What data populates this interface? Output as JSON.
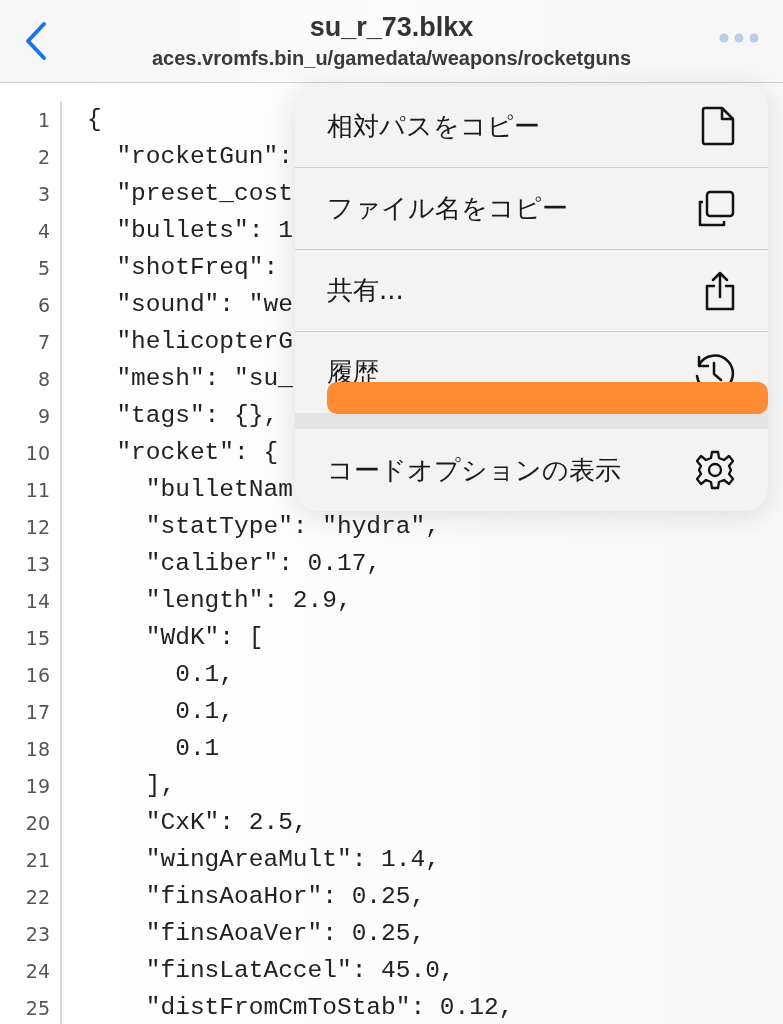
{
  "header": {
    "title": "su_r_73.blkx",
    "subtitle": "aces.vromfs.bin_u/gamedata/weapons/rocketguns"
  },
  "code_lines": [
    {
      "number": "1",
      "text": "{"
    },
    {
      "number": "2",
      "text": "  \"rocketGun\":"
    },
    {
      "number": "3",
      "text": "  \"preset_cost"
    },
    {
      "number": "4",
      "text": "  \"bullets\": 1"
    },
    {
      "number": "5",
      "text": "  \"shotFreq\":"
    },
    {
      "number": "6",
      "text": "  \"sound\": \"we"
    },
    {
      "number": "7",
      "text": "  \"helicopterG"
    },
    {
      "number": "8",
      "text": "  \"mesh\": \"su_"
    },
    {
      "number": "9",
      "text": "  \"tags\": {},"
    },
    {
      "number": "10",
      "text": "  \"rocket\": {"
    },
    {
      "number": "11",
      "text": "    \"bulletNam"
    },
    {
      "number": "12",
      "text": "    \"statType\": \"hydra\","
    },
    {
      "number": "13",
      "text": "    \"caliber\": 0.17,"
    },
    {
      "number": "14",
      "text": "    \"length\": 2.9,"
    },
    {
      "number": "15",
      "text": "    \"WdK\": ["
    },
    {
      "number": "16",
      "text": "      0.1,"
    },
    {
      "number": "17",
      "text": "      0.1,"
    },
    {
      "number": "18",
      "text": "      0.1"
    },
    {
      "number": "19",
      "text": "    ],"
    },
    {
      "number": "20",
      "text": "    \"CxK\": 2.5,"
    },
    {
      "number": "21",
      "text": "    \"wingAreaMult\": 1.4,"
    },
    {
      "number": "22",
      "text": "    \"finsAoaHor\": 0.25,"
    },
    {
      "number": "23",
      "text": "    \"finsAoaVer\": 0.25,"
    },
    {
      "number": "24",
      "text": "    \"finsLatAccel\": 45.0,"
    },
    {
      "number": "25",
      "text": "    \"distFromCmToStab\": 0.12,"
    }
  ],
  "menu": [
    {
      "label": "相対パスをコピー",
      "kind": "file"
    },
    {
      "label": "ファイル名をコピー",
      "kind": "copy"
    },
    {
      "label": "共有...",
      "kind": "share"
    },
    {
      "label": "履歴",
      "kind": "history"
    },
    {
      "label": "コードオプションの表示",
      "kind": "settings"
    }
  ]
}
